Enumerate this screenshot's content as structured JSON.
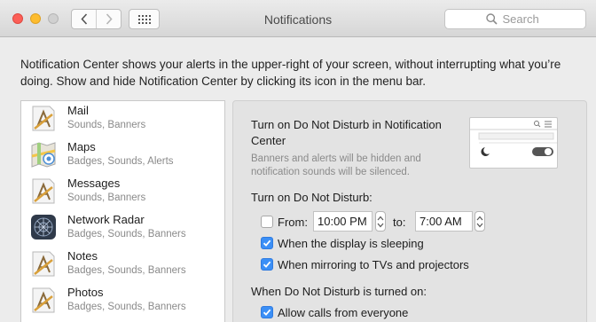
{
  "window": {
    "title": "Notifications"
  },
  "toolbar": {
    "back_icon": "chevron-left-icon",
    "forward_icon": "chevron-right-icon",
    "grid_icon": "grid-icon",
    "search_placeholder": "Search"
  },
  "description": "Notification Center shows your alerts in the upper-right of your screen, without interrupting what you’re doing. Show and hide Notification Center by clicking its icon in the menu bar.",
  "apps": [
    {
      "name": "Mail",
      "subtitle": "Sounds, Banners",
      "icon": "mail-icon"
    },
    {
      "name": "Maps",
      "subtitle": "Badges, Sounds, Alerts",
      "icon": "maps-icon"
    },
    {
      "name": "Messages",
      "subtitle": "Sounds, Banners",
      "icon": "messages-icon"
    },
    {
      "name": "Network Radar",
      "subtitle": "Badges, Sounds, Banners",
      "icon": "network-radar-icon"
    },
    {
      "name": "Notes",
      "subtitle": "Badges, Sounds, Banners",
      "icon": "notes-icon"
    },
    {
      "name": "Photos",
      "subtitle": "Badges, Sounds, Banners",
      "icon": "photos-icon"
    }
  ],
  "dnd": {
    "title": "Turn on Do Not Disturb in Notification Center",
    "note": "Banners and alerts will be hidden and notification sounds will be silenced.",
    "schedule_label": "Turn on Do Not Disturb:",
    "from_label": "From:",
    "from_checked": false,
    "from_time": "10:00 PM",
    "to_label": "to:",
    "to_time": "7:00 AM",
    "display_sleeping_label": "When the display is sleeping",
    "display_sleeping_checked": true,
    "mirroring_label": "When mirroring to TVs and projectors",
    "mirroring_checked": true,
    "when_on_label": "When Do Not Disturb is turned on:",
    "allow_calls_label": "Allow calls from everyone",
    "allow_calls_checked": true
  },
  "colors": {
    "accent": "#3b8ff6",
    "close": "#fc5f57",
    "minimize": "#fdbc2e",
    "zoom_disabled": "#d0d0d0"
  }
}
